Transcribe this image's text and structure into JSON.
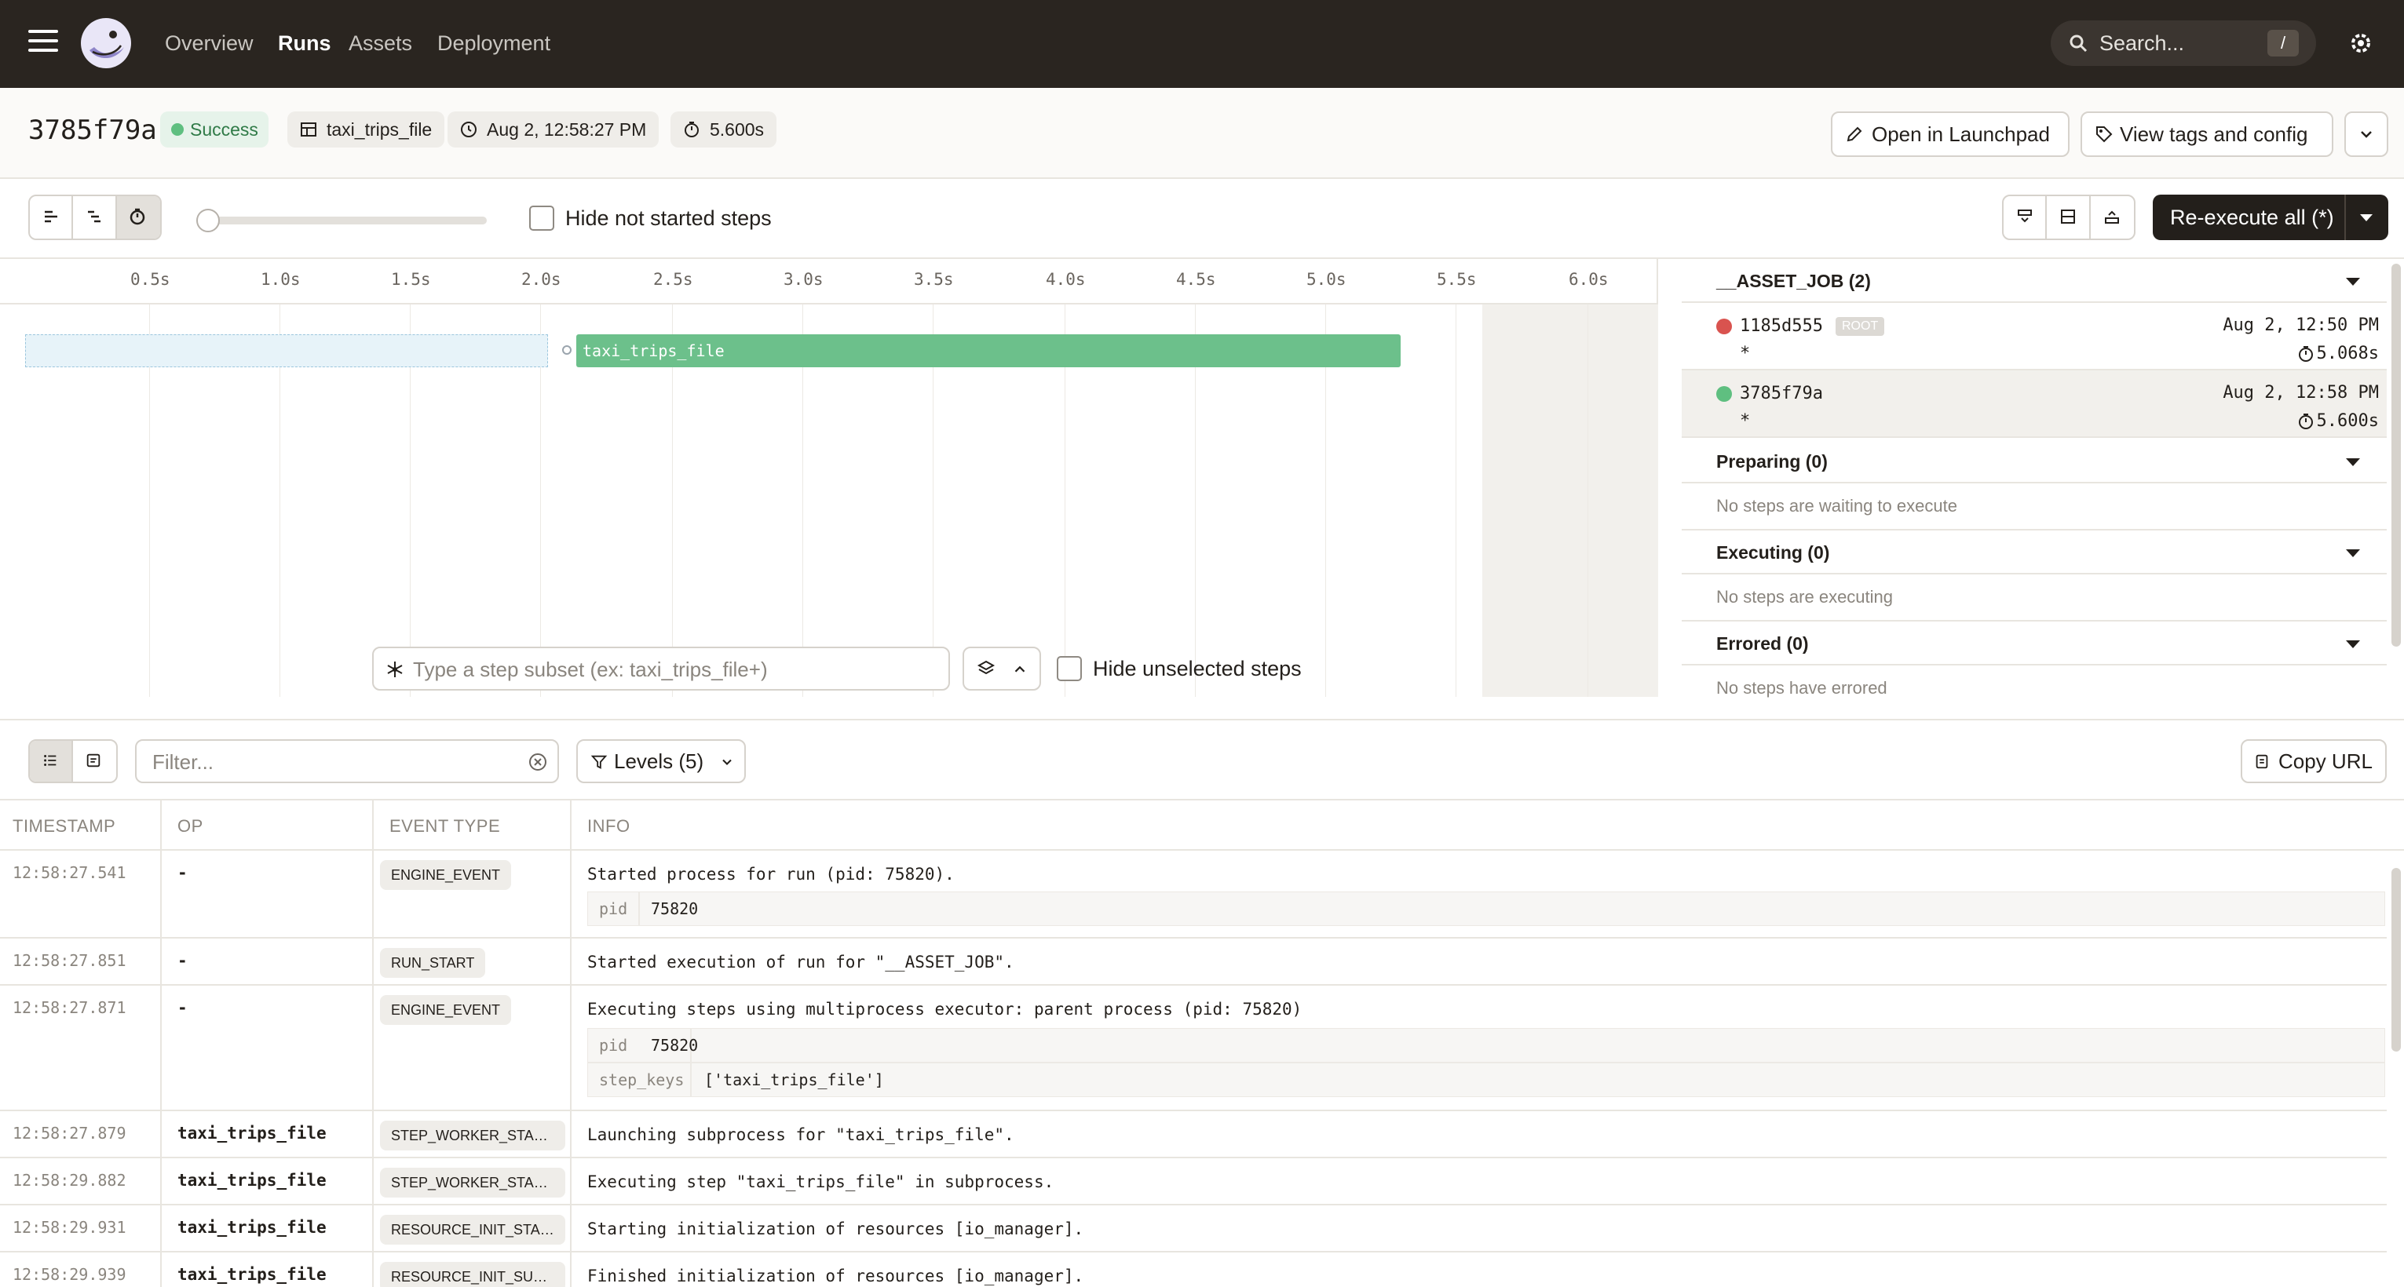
{
  "nav": {
    "links": [
      "Overview",
      "Runs",
      "Assets",
      "Deployment"
    ],
    "active": "Runs",
    "search_placeholder": "Search...",
    "search_shortcut": "/"
  },
  "run": {
    "id": "3785f79a",
    "status": "Success",
    "job": "taxi_trips_file",
    "started": "Aug 2, 12:58:27 PM",
    "duration": "5.600s",
    "open_launchpad": "Open in Launchpad",
    "view_tags": "View tags and config"
  },
  "toolbar": {
    "hide_not_started": "Hide not started steps",
    "reexecute": "Re-execute all (*)"
  },
  "gantt": {
    "ticks": [
      "0.5s",
      "1.0s",
      "1.5s",
      "2.0s",
      "2.5s",
      "3.0s",
      "3.5s",
      "4.0s",
      "4.5s",
      "5.0s",
      "5.5s",
      "6.0s"
    ],
    "step_name": "taxi_trips_file",
    "subset_placeholder": "Type a step subset (ex: taxi_trips_file+)",
    "hide_unselected": "Hide unselected steps"
  },
  "panel": {
    "job_header": "__ASSET_JOB (2)",
    "runs": [
      {
        "id": "1185d555",
        "tag": "ROOT",
        "subset": "*",
        "time": "Aug 2, 12:50 PM",
        "duration": "5.068s",
        "status_color": "#d9534f"
      },
      {
        "id": "3785f79a",
        "tag": "",
        "subset": "*",
        "time": "Aug 2, 12:58 PM",
        "duration": "5.600s",
        "status_color": "#5fbf80"
      }
    ],
    "preparing": "Preparing (0)",
    "preparing_empty": "No steps are waiting to execute",
    "executing": "Executing (0)",
    "executing_empty": "No steps are executing",
    "errored": "Errored (0)",
    "errored_empty": "No steps have errored"
  },
  "logs": {
    "filter_placeholder": "Filter...",
    "levels": "Levels (5)",
    "copy_url": "Copy URL",
    "columns": [
      "TIMESTAMP",
      "OP",
      "EVENT TYPE",
      "INFO"
    ],
    "rows": [
      {
        "ts": "12:58:27.541",
        "op": "-",
        "type": "ENGINE_EVENT",
        "info": "Started process for run (pid: 75820).",
        "kv": [
          [
            "pid",
            "75820"
          ]
        ]
      },
      {
        "ts": "12:58:27.851",
        "op": "-",
        "type": "RUN_START",
        "info": "Started execution of run for \"__ASSET_JOB\".",
        "kv": []
      },
      {
        "ts": "12:58:27.871",
        "op": "-",
        "type": "ENGINE_EVENT",
        "info": "Executing steps using multiprocess executor: parent process (pid: 75820)",
        "kv": [
          [
            "pid",
            "75820"
          ],
          [
            "step_keys",
            "['taxi_trips_file']"
          ]
        ]
      },
      {
        "ts": "12:58:27.879",
        "op": "taxi_trips_file",
        "type": "STEP_WORKER_STARTI...",
        "info": "Launching subprocess for \"taxi_trips_file\".",
        "kv": []
      },
      {
        "ts": "12:58:29.882",
        "op": "taxi_trips_file",
        "type": "STEP_WORKER_STARTED",
        "info": "Executing step \"taxi_trips_file\" in subprocess.",
        "kv": []
      },
      {
        "ts": "12:58:29.931",
        "op": "taxi_trips_file",
        "type": "RESOURCE_INIT_STAR...",
        "info": "Starting initialization of resources [io_manager].",
        "kv": []
      },
      {
        "ts": "12:58:29.939",
        "op": "taxi_trips_file",
        "type": "RESOURCE_INIT_SUCC...",
        "info": "Finished initialization of resources [io_manager].",
        "kv": []
      }
    ]
  }
}
